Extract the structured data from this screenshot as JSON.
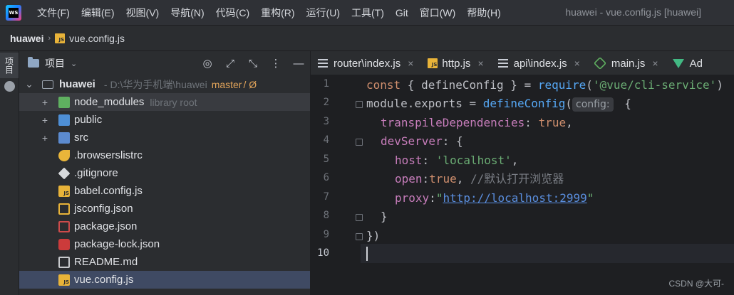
{
  "app": {
    "logo_text": "WS"
  },
  "menu": [
    "文件(F)",
    "编辑(E)",
    "视图(V)",
    "导航(N)",
    "代码(C)",
    "重构(R)",
    "运行(U)",
    "工具(T)",
    "Git",
    "窗口(W)",
    "帮助(H)"
  ],
  "window_title": "huawei - vue.config.js [huawei]",
  "breadcrumb": {
    "project": "huawei",
    "file": "vue.config.js"
  },
  "toolstrip": {
    "project_tab": "项目"
  },
  "project_panel": {
    "title": "项目",
    "root": {
      "name": "huawei",
      "path": "D:\\华为手机端\\huawei",
      "branch": "master",
      "branch_status": "/ Ø"
    },
    "items": [
      {
        "name": "node_modules",
        "hint": "library root",
        "expandable": true
      },
      {
        "name": "public",
        "hint": "",
        "expandable": true
      },
      {
        "name": "src",
        "hint": "",
        "expandable": true
      },
      {
        "name": ".browserslistrc",
        "hint": "",
        "expandable": false
      },
      {
        "name": ".gitignore",
        "hint": "",
        "expandable": false
      },
      {
        "name": "babel.config.js",
        "hint": "",
        "expandable": false
      },
      {
        "name": "jsconfig.json",
        "hint": "",
        "expandable": false
      },
      {
        "name": "package.json",
        "hint": "",
        "expandable": false
      },
      {
        "name": "package-lock.json",
        "hint": "",
        "expandable": false
      },
      {
        "name": "README.md",
        "hint": "",
        "expandable": false
      },
      {
        "name": "vue.config.js",
        "hint": "",
        "expandable": false,
        "selected": true
      }
    ]
  },
  "tabs": [
    {
      "label": "router\\index.js",
      "icon": "lines-icon"
    },
    {
      "label": "http.js",
      "icon": "js-icon"
    },
    {
      "label": "api\\index.js",
      "icon": "lines-icon"
    },
    {
      "label": "main.js",
      "icon": "node-icon"
    },
    {
      "label": "Ad",
      "icon": "vue-icon"
    }
  ],
  "editor": {
    "line_numbers": [
      "1",
      "2",
      "3",
      "4",
      "5",
      "6",
      "7",
      "8",
      "9",
      "10"
    ],
    "active_line": "10",
    "lines": {
      "l1": {
        "kw1": "const",
        "p1": " { ",
        "id1": "defineConfig",
        "p2": " } = ",
        "fn": "require",
        "p3": "(",
        "str": "'@vue/cli-service'",
        "p4": ")"
      },
      "l2": {
        "id1": "module",
        "p1": ".",
        "id2": "exports",
        "p2": " = ",
        "fn": "defineConfig",
        "p3": "(",
        "hint": "config:",
        "p4": " {"
      },
      "l3": {
        "prop": "transpileDependencies",
        "p1": ": ",
        "kw": "true",
        "p2": ","
      },
      "l4": {
        "prop": "devServer",
        "p1": ": {"
      },
      "l5": {
        "prop": "host",
        "p1": ": ",
        "str": "'localhost'",
        "p2": ","
      },
      "l6": {
        "prop": "open",
        "p1": ":",
        "kw": "true",
        "p2": ", ",
        "cmt": "//默认打开浏览器"
      },
      "l7": {
        "prop": "proxy",
        "p1": ":",
        "q1": "\"",
        "link": "http://localhost:2999",
        "q2": "\""
      },
      "l8": {
        "p1": "}"
      },
      "l9": {
        "p1": "})"
      },
      "l10": {
        "p1": ""
      }
    }
  },
  "watermark": "CSDN @大可-",
  "colors": {
    "accent_selection": "#3f4a63",
    "editor_bg": "#1e1f22",
    "keyword": "#cf8e6d",
    "string": "#6aab73",
    "property": "#c77dbb"
  }
}
